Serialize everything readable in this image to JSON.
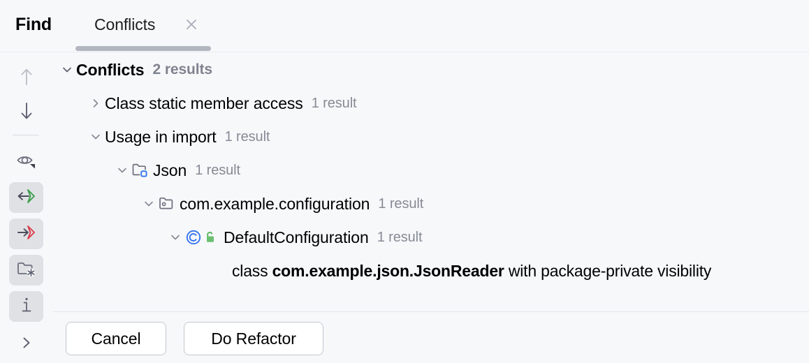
{
  "window": {
    "title": "Find",
    "background_color": "#F7F8FA"
  },
  "tabbar": {
    "title": "Find",
    "tab_label": "Conflicts",
    "close_icon": "close-icon",
    "underline_color": "#B2B6BF"
  },
  "toolbar": {
    "items": [
      {
        "name": "previous-occurrence",
        "icon": "arrow-up-icon",
        "state": "disabled",
        "pressed": false
      },
      {
        "name": "next-occurrence",
        "icon": "arrow-down-icon",
        "state": "enabled",
        "pressed": false
      },
      {
        "name": "preview-usages",
        "icon": "eye-icon",
        "state": "enabled",
        "pressed": false
      },
      {
        "name": "show-import-statements",
        "icon": "arrow-left-into-brace-icon",
        "state": "enabled",
        "pressed": true
      },
      {
        "name": "show-read-access",
        "icon": "arrow-right-into-brace-icon",
        "state": "enabled",
        "pressed": true
      },
      {
        "name": "group-by-directory",
        "icon": "folder-snowflake-icon",
        "state": "enabled",
        "pressed": true
      },
      {
        "name": "show-details",
        "icon": "info-icon",
        "state": "enabled",
        "pressed": true
      },
      {
        "name": "expand-toolbar",
        "icon": "chevron-right-icon",
        "state": "enabled",
        "pressed": false
      }
    ]
  },
  "tree": {
    "nodes": [
      {
        "id": "root",
        "indent": 0,
        "chevron": "down",
        "icon": null,
        "label": "Conflicts",
        "bold": true,
        "count": "2 results",
        "count_bold": true
      },
      {
        "id": "class-static-member-access",
        "indent": 1,
        "chevron": "right",
        "icon": null,
        "label": "Class static member access",
        "bold": false,
        "count": "1 result",
        "count_bold": false
      },
      {
        "id": "usage-in-import",
        "indent": 1,
        "chevron": "down",
        "icon": null,
        "label": "Usage in import",
        "bold": false,
        "count": "1 result",
        "count_bold": false
      },
      {
        "id": "module-json",
        "indent": 2,
        "chevron": "down",
        "icon": "module-folder-icon",
        "label": "Json",
        "bold": false,
        "count": "1 result",
        "count_bold": false
      },
      {
        "id": "package-com-example-configuration",
        "indent": 3,
        "chevron": "down",
        "icon": "package-icon",
        "label": "com.example.configuration",
        "bold": false,
        "count": "1 result",
        "count_bold": false
      },
      {
        "id": "class-default-configuration",
        "indent": 4,
        "chevron": "down",
        "icon": "class-icon",
        "badge": "unlocked-green-icon",
        "label": "DefaultConfiguration",
        "bold": false,
        "count": "1 result",
        "count_bold": false
      }
    ],
    "detail_row": {
      "prefix": "class ",
      "emphasis": "com.example.json.JsonReader",
      "suffix": " with package-private visibility"
    }
  },
  "footer": {
    "cancel_label": "Cancel",
    "refactor_label": "Do Refactor"
  },
  "colors": {
    "background": "#F7F8FA",
    "count_text": "#868A94",
    "class_icon_blue": "#3574F0",
    "lock_green": "#5FB865",
    "brace_green": "#3C9D4B",
    "brace_red": "#DB3B4B",
    "icon_gray": "#6C707E"
  }
}
